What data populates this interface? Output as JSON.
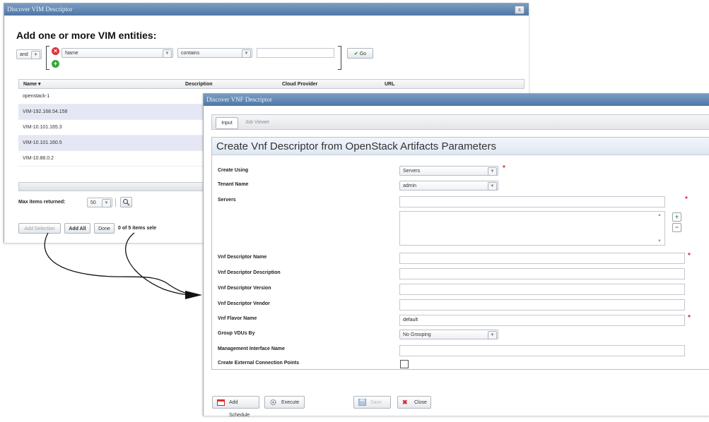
{
  "window1": {
    "title": "Discover VIM Descriptor",
    "close": "x",
    "heading": "Add one or more VIM entities:",
    "filter": {
      "logic": "and",
      "field": "Name",
      "operator": "contains",
      "value": "",
      "go_label": "Go"
    },
    "columns": [
      "Name ▾",
      "Description",
      "Cloud Provider",
      "URL"
    ],
    "rows": [
      "openstack-1",
      "VIM-192.168.54.158",
      "VIM-10.101.165.3",
      "VIM-10.101.160.5",
      "VIM-10.88.0.2"
    ],
    "max_items_label": "Max items returned:",
    "max_items_value": "50",
    "buttons": {
      "add_selection": "Add Selection",
      "add_all": "Add All",
      "done": "Done"
    },
    "status": "0 of 5 items sele"
  },
  "window2": {
    "title": "Discover VNF Descriptor",
    "tabs": [
      "Input",
      "Job Viewer"
    ],
    "panel_title": "Create Vnf Descriptor from OpenStack Artifacts Parameters",
    "fields": {
      "create_using": {
        "label": "Create Using",
        "value": "Servers"
      },
      "tenant_name": {
        "label": "Tenant Name",
        "value": "admin"
      },
      "servers": {
        "label": "Servers"
      },
      "vnf_descriptor_name": {
        "label": "Vnf Descriptor Name",
        "value": ""
      },
      "vnf_descriptor_description": {
        "label": "Vnf Descriptor Description",
        "value": ""
      },
      "vnf_descriptor_version": {
        "label": "Vnf Descriptor Version",
        "value": ""
      },
      "vnf_descriptor_vendor": {
        "label": "Vnf Descriptor Vendor",
        "value": ""
      },
      "vnf_flavor_name": {
        "label": "Vnf Flavor Name",
        "value": "default"
      },
      "group_vdus_by": {
        "label": "Group VDUs By",
        "value": "No Grouping"
      },
      "management_interface_name": {
        "label": "Management Interface Name",
        "value": ""
      },
      "create_external_connection_points": {
        "label": "Create External Connection Points",
        "checked": false
      }
    },
    "buttons": {
      "add_schedule": "Add Schedule",
      "execute": "Execute",
      "save": "Save",
      "close": "Close"
    }
  },
  "colors": {
    "titlebar": "#5a80ad",
    "row_highlight": "#e6e7f4",
    "required": "#dd2233",
    "go_check": "#3aa53a"
  }
}
